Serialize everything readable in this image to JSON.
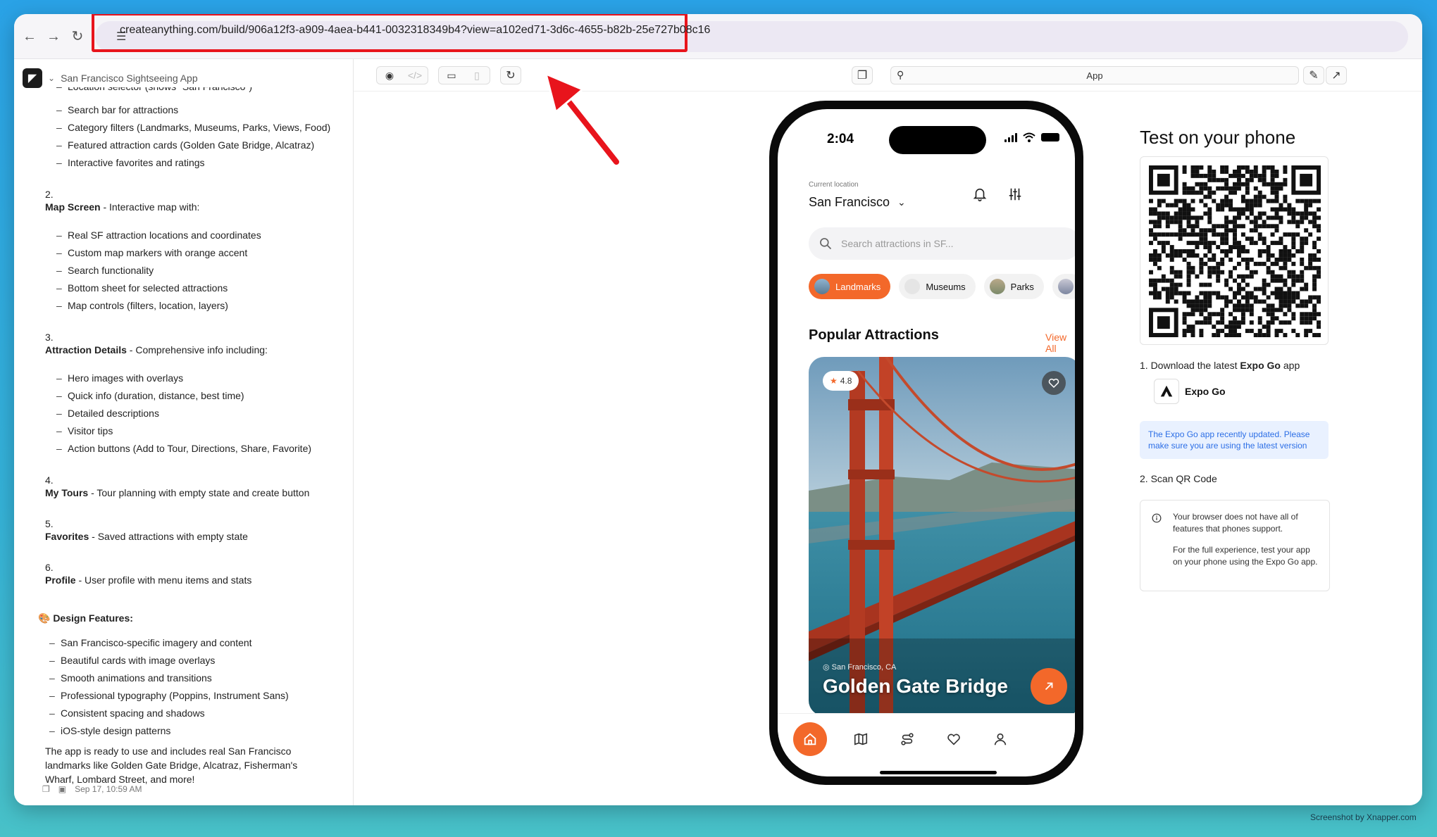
{
  "browser": {
    "url": "createanything.com/build/906a12f3-a909-4aea-b441-0032318349b4?view=a102ed71-3d6c-4655-b82b-25e727b08c16",
    "back_icon": "arrow-left-icon",
    "forward_icon": "arrow-right-icon",
    "reload_icon": "reload-icon"
  },
  "project": {
    "name": "San Francisco Sightseeing App"
  },
  "chat": {
    "top_items": [
      "Location selector (shows \"San Francisco\")",
      "Search bar for attractions",
      "Category filters (Landmarks, Museums, Parks, Views, Food)",
      "Featured attraction cards (Golden Gate Bridge, Alcatraz)",
      "Interactive favorites and ratings"
    ],
    "sections": [
      {
        "number": "2.",
        "title": "Map Screen",
        "desc": " - Interactive map with:",
        "items": [
          "Real SF attraction locations and coordinates",
          "Custom map markers with orange accent",
          "Search functionality",
          "Bottom sheet for selected attractions",
          "Map controls (filters, location, layers)"
        ]
      },
      {
        "number": "3.",
        "title": "Attraction Details",
        "desc": " - Comprehensive info including:",
        "items": [
          "Hero images with overlays",
          "Quick info (duration, distance, best time)",
          "Detailed descriptions",
          "Visitor tips",
          "Action buttons (Add to Tour, Directions, Share, Favorite)"
        ]
      },
      {
        "number": "4.",
        "title": "My Tours",
        "desc": " - Tour planning with empty state and create button",
        "items": []
      },
      {
        "number": "5.",
        "title": "Favorites",
        "desc": " - Saved attractions with empty state",
        "items": []
      },
      {
        "number": "6.",
        "title": "Profile",
        "desc": " - User profile with menu items and stats",
        "items": []
      }
    ],
    "design_heading": "🎨 Design Features:",
    "design_items": [
      "San Francisco-specific imagery and content",
      "Beautiful cards with image overlays",
      "Smooth animations and transitions",
      "Professional typography (Poppins, Instrument Sans)",
      "Consistent spacing and shadows",
      "iOS-style design patterns"
    ],
    "closing": "The app is ready to use and includes real San Francisco landmarks like Golden Gate Bridge, Alcatraz, Fisherman's Wharf, Lombard Street, and more!",
    "timestamp": "Sep 17, 10:59 AM"
  },
  "preview": {
    "address_label": "App"
  },
  "phone": {
    "time": "2:04",
    "location_caption": "Current location",
    "city": "San Francisco",
    "search_placeholder": "Search attractions in SF...",
    "chips": [
      "Landmarks",
      "Museums",
      "Parks"
    ],
    "section_title": "Popular Attractions",
    "view_all": "View All",
    "card": {
      "rating": "4.8",
      "location": "San Francisco, CA",
      "title": "Golden Gate Bridge"
    },
    "colors": {
      "accent": "#f3682a"
    }
  },
  "right": {
    "title": "Test on your phone",
    "step1_prefix": "1. Download the latest ",
    "step1_bold": "Expo Go",
    "step1_suffix": " app",
    "expo_label": "Expo Go",
    "notice": "The Expo Go app recently updated. Please make sure you are using the latest version",
    "step2": "2. Scan QR Code",
    "warn1": "Your browser does not have all of features that phones support.",
    "warn2": "For the full experience, test your app on your phone using the Expo Go app."
  },
  "credit": "Screenshot by Xnapper.com"
}
